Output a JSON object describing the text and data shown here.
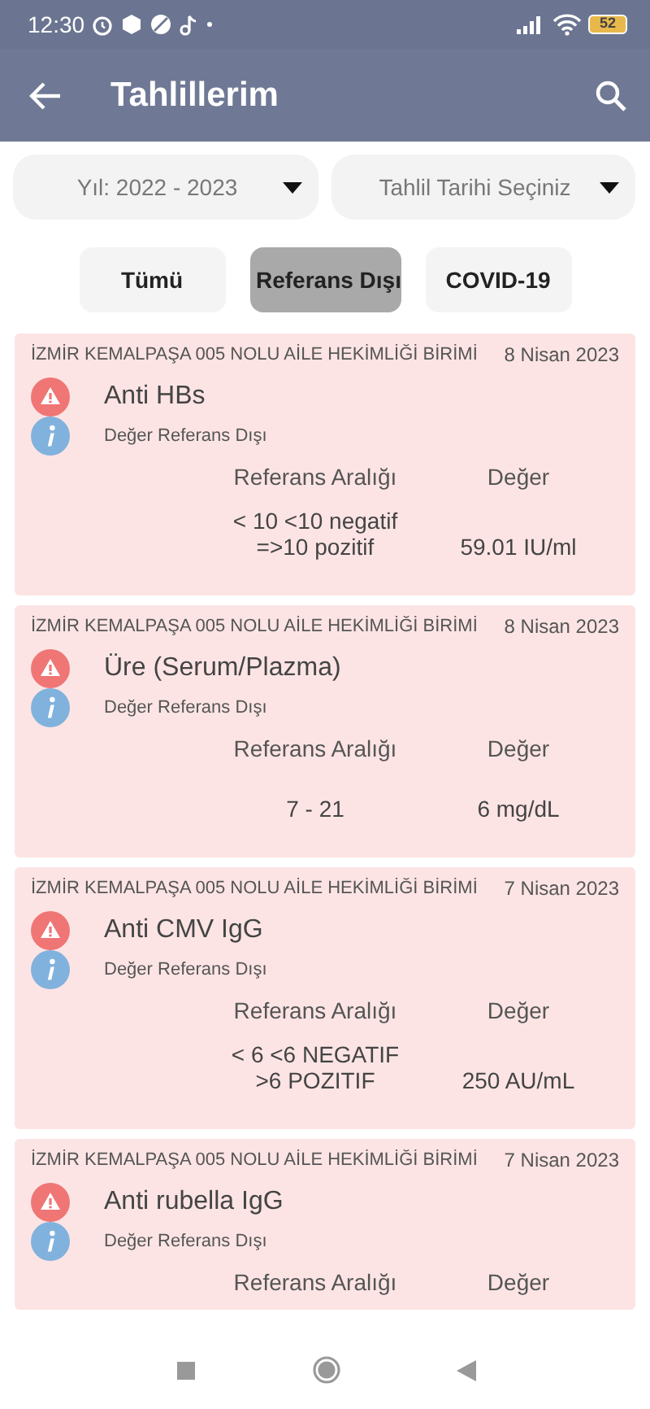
{
  "status_bar": {
    "time": "12:30",
    "battery": "52"
  },
  "app_bar": {
    "title": "Tahlillerim"
  },
  "dropdowns": [
    {
      "value": "Yıl: 2022 - 2023"
    },
    {
      "value": "Tahlil Tarihi Seçiniz"
    }
  ],
  "filters": [
    {
      "label": "Tümü",
      "selected": false
    },
    {
      "label": "Referans Dışı",
      "selected": true
    },
    {
      "label": "COVID-19",
      "selected": false
    }
  ],
  "results": [
    {
      "clinic": "İZMİR KEMALPAŞA 005 NOLU AİLE HEKİMLİĞİ BİRİMİ",
      "date": "8 Nisan 2023",
      "test": "Anti HBs",
      "status": "Değer Referans Dışı",
      "range_header": "Referans Aralığı",
      "value_header": "Değer",
      "range": "< 10 <10 negatif\n=>10 pozitif",
      "value": "59.01 IU/ml"
    },
    {
      "clinic": "İZMİR KEMALPAŞA 005 NOLU AİLE HEKİMLİĞİ BİRİMİ",
      "date": "8 Nisan 2023",
      "test": "Üre (Serum/Plazma)",
      "status": "Değer Referans Dışı",
      "range_header": "Referans Aralığı",
      "value_header": "Değer",
      "range": "7 - 21",
      "value": "6 mg/dL"
    },
    {
      "clinic": "İZMİR KEMALPAŞA 005 NOLU AİLE HEKİMLİĞİ BİRİMİ",
      "date": "7 Nisan 2023",
      "test": "Anti CMV IgG",
      "status": "Değer Referans Dışı",
      "range_header": "Referans Aralığı",
      "value_header": "Değer",
      "range": "< 6 <6 NEGATIF\n>6 POZITIF",
      "value": "250 AU/mL"
    },
    {
      "clinic": "İZMİR KEMALPAŞA 005 NOLU AİLE HEKİMLİĞİ BİRİMİ",
      "date": "7 Nisan 2023",
      "test": "Anti rubella IgG",
      "status": "Değer Referans Dışı",
      "range_header": "Referans Aralığı",
      "value_header": "Değer"
    }
  ]
}
